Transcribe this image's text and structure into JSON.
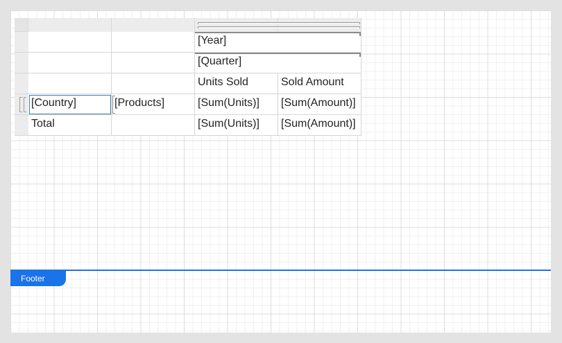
{
  "designer": {
    "footer_label": "Footer"
  },
  "tablix": {
    "column_groups": {
      "year": "[Year]",
      "quarter": "[Quarter]"
    },
    "column_headers": [
      "Units Sold",
      "Sold Amount"
    ],
    "row_groups": {
      "country": "[Country]",
      "products": "[Products]"
    },
    "detail_row": [
      "[Sum(Units)]",
      "[Sum(Amount)]"
    ],
    "total_row": {
      "label": "Total",
      "values": [
        "[Sum(Units)]",
        "[Sum(Amount)]"
      ]
    }
  },
  "colors": {
    "band_accent": "#1a73e8",
    "selection": "#3b7fb8"
  }
}
